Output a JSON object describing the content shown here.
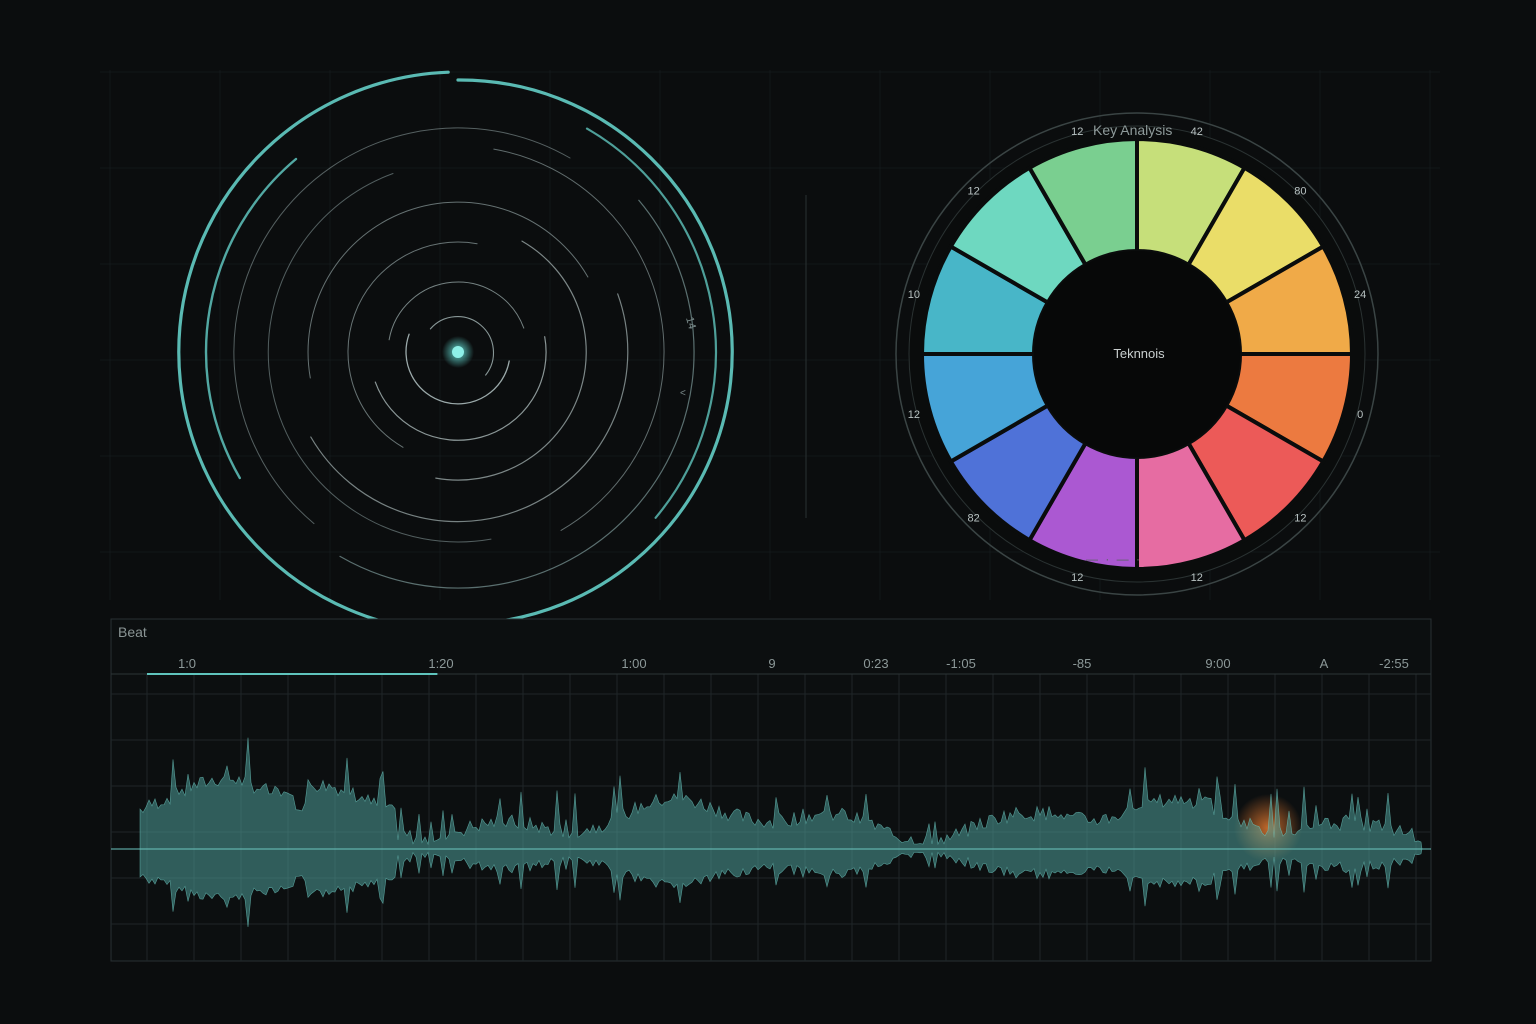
{
  "key_analysis": {
    "title": "Key Analysis",
    "center_label": "Teknnois",
    "footer": "— · — ·",
    "segments": [
      {
        "label": "42",
        "color": "#c6df7a"
      },
      {
        "label": "80",
        "color": "#eadd68"
      },
      {
        "label": "24",
        "color": "#f0aa48"
      },
      {
        "label": "0",
        "color": "#ec7a40"
      },
      {
        "label": "12",
        "color": "#ec5a58"
      },
      {
        "label": "12",
        "color": "#e66ca2"
      },
      {
        "label": "12",
        "color": "#ab58d2"
      },
      {
        "label": "82",
        "color": "#4f72d8"
      },
      {
        "label": "12",
        "color": "#46a4d8"
      },
      {
        "label": "10",
        "color": "#48b6c8"
      },
      {
        "label": "12",
        "color": "#6ed8c0"
      },
      {
        "label": "12",
        "color": "#7acf90"
      }
    ]
  },
  "beat": {
    "title": "Beat",
    "ticks": [
      "1:0",
      "1:20",
      "1:00",
      "9",
      "0:23",
      "-1:05",
      "-85",
      "9:00",
      "A",
      "-2:55"
    ],
    "progress": 0.22,
    "accent_color": "#5fc4bd",
    "marker_color": "#e07830"
  },
  "tempo_dial": {
    "side_labels": [
      "14",
      "<"
    ],
    "color": "#5fc4bd"
  }
}
